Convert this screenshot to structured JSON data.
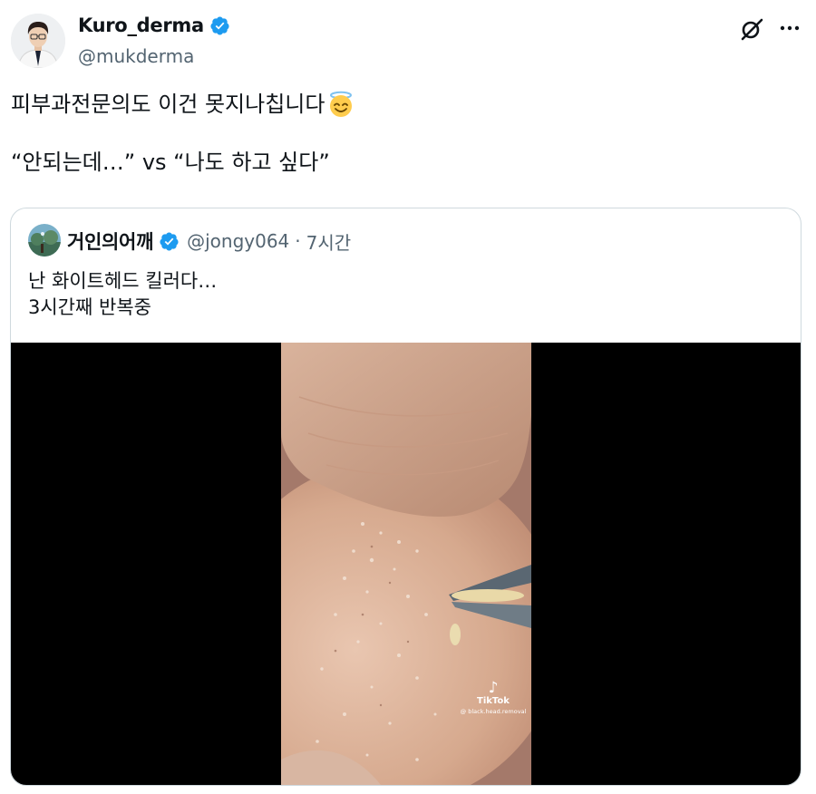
{
  "tweet": {
    "author": {
      "display_name": "Kuro_derma",
      "handle": "@mukderma",
      "verified": true,
      "avatar_icon": "doctor-avatar"
    },
    "text_line1": "피부과전문의도 이건 못지나칩니다",
    "text_line1_emoji": "smiling-face-with-halo",
    "text_line2": "“안되는데…” vs “나도 하고 싶다”",
    "header_icons": [
      "grok-icon",
      "more-icon"
    ]
  },
  "quoted_tweet": {
    "author": {
      "display_name": "거인의어깨",
      "handle": "@jongy064",
      "verified": true,
      "avatar_icon": "landscape-avatar"
    },
    "separator": "·",
    "time": "7시간",
    "text_line1": "난 화이트헤드 킬러다…",
    "text_line2": "3시간째 반복중",
    "media": {
      "type": "video",
      "watermark_brand": "TikTok",
      "watermark_user": "@ black.head.removal"
    }
  },
  "colors": {
    "text_primary": "#0f1419",
    "text_secondary": "#536471",
    "verified_blue": "#1d9bf0",
    "border": "#cfd9de",
    "media_background": "#000000"
  }
}
